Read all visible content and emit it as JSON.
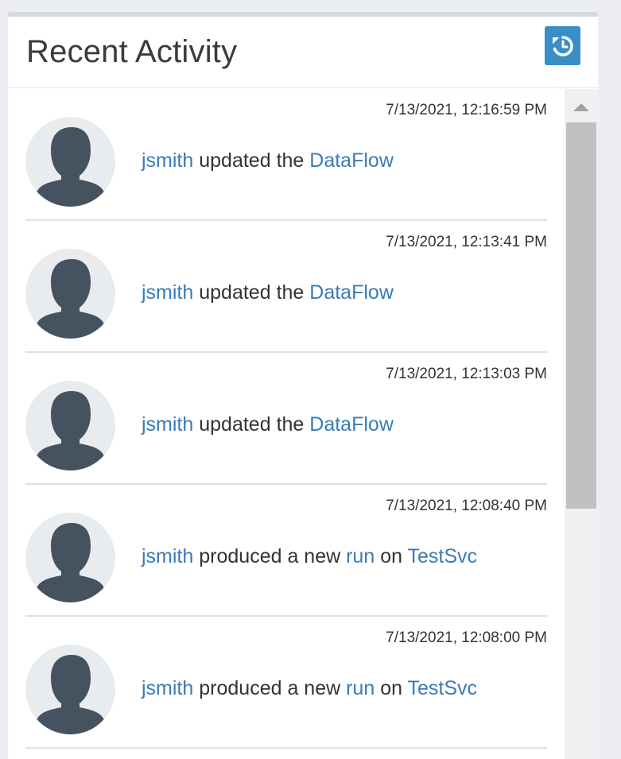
{
  "panel": {
    "title": "Recent Activity",
    "refresh_icon": "history-refresh-icon"
  },
  "colors": {
    "accent": "#3a8ec7",
    "link": "#3a7bb8",
    "avatar_bg": "#e9ecef",
    "avatar_figure": "#44535f"
  },
  "activities": [
    {
      "timestamp": "7/13/2021, 12:16:59 PM",
      "user": "jsmith",
      "action": "updated the",
      "target": "DataFlow",
      "avatar_icon": "user-avatar-icon"
    },
    {
      "timestamp": "7/13/2021, 12:13:41 PM",
      "user": "jsmith",
      "action": "updated the",
      "target": "DataFlow",
      "avatar_icon": "user-avatar-icon"
    },
    {
      "timestamp": "7/13/2021, 12:13:03 PM",
      "user": "jsmith",
      "action": "updated the",
      "target": "DataFlow",
      "avatar_icon": "user-avatar-icon"
    },
    {
      "timestamp": "7/13/2021, 12:08:40 PM",
      "user": "jsmith",
      "action": "produced a new",
      "object": "run",
      "connector": "on",
      "target": "TestSvc",
      "avatar_icon": "user-avatar-icon"
    },
    {
      "timestamp": "7/13/2021, 12:08:00 PM",
      "user": "jsmith",
      "action": "produced a new",
      "object": "run",
      "connector": "on",
      "target": "TestSvc",
      "avatar_icon": "user-avatar-icon"
    }
  ]
}
